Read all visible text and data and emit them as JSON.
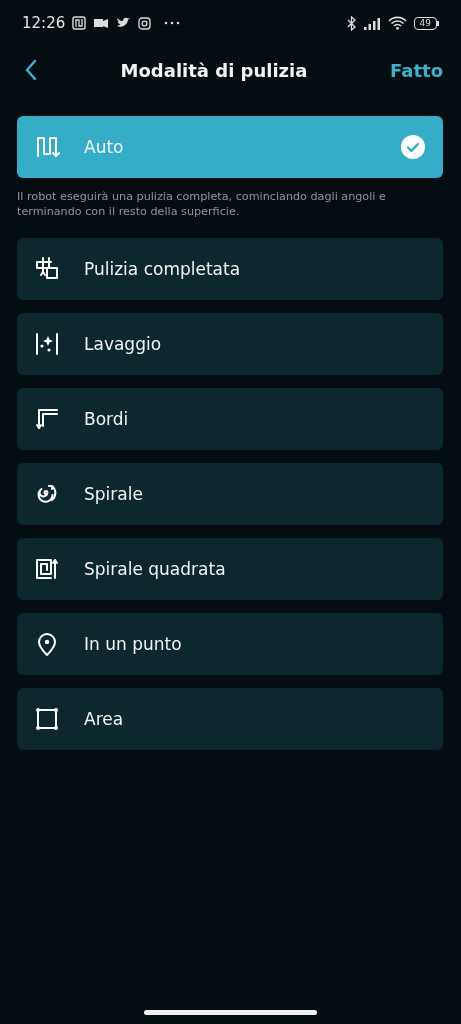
{
  "status_bar": {
    "time": "12:26",
    "battery": "49"
  },
  "header": {
    "title": "Modalità di pulizia",
    "action": "Fatto"
  },
  "modes": [
    {
      "kind": "zigzag",
      "label": "Auto",
      "selected": true,
      "description": "Il robot eseguirà una pulizia completa, cominciando dagli angoli e terminando con il resto della superficie."
    },
    {
      "kind": "grid",
      "label": "Pulizia completata",
      "selected": false
    },
    {
      "kind": "sparkle",
      "label": "Lavaggio",
      "selected": false
    },
    {
      "kind": "corner",
      "label": "Bordi",
      "selected": false
    },
    {
      "kind": "spiral",
      "label": "Spirale",
      "selected": false
    },
    {
      "kind": "square-spiral",
      "label": "Spirale quadrata",
      "selected": false
    },
    {
      "kind": "pin",
      "label": "In un punto",
      "selected": false
    },
    {
      "kind": "area",
      "label": "Area",
      "selected": false
    }
  ]
}
